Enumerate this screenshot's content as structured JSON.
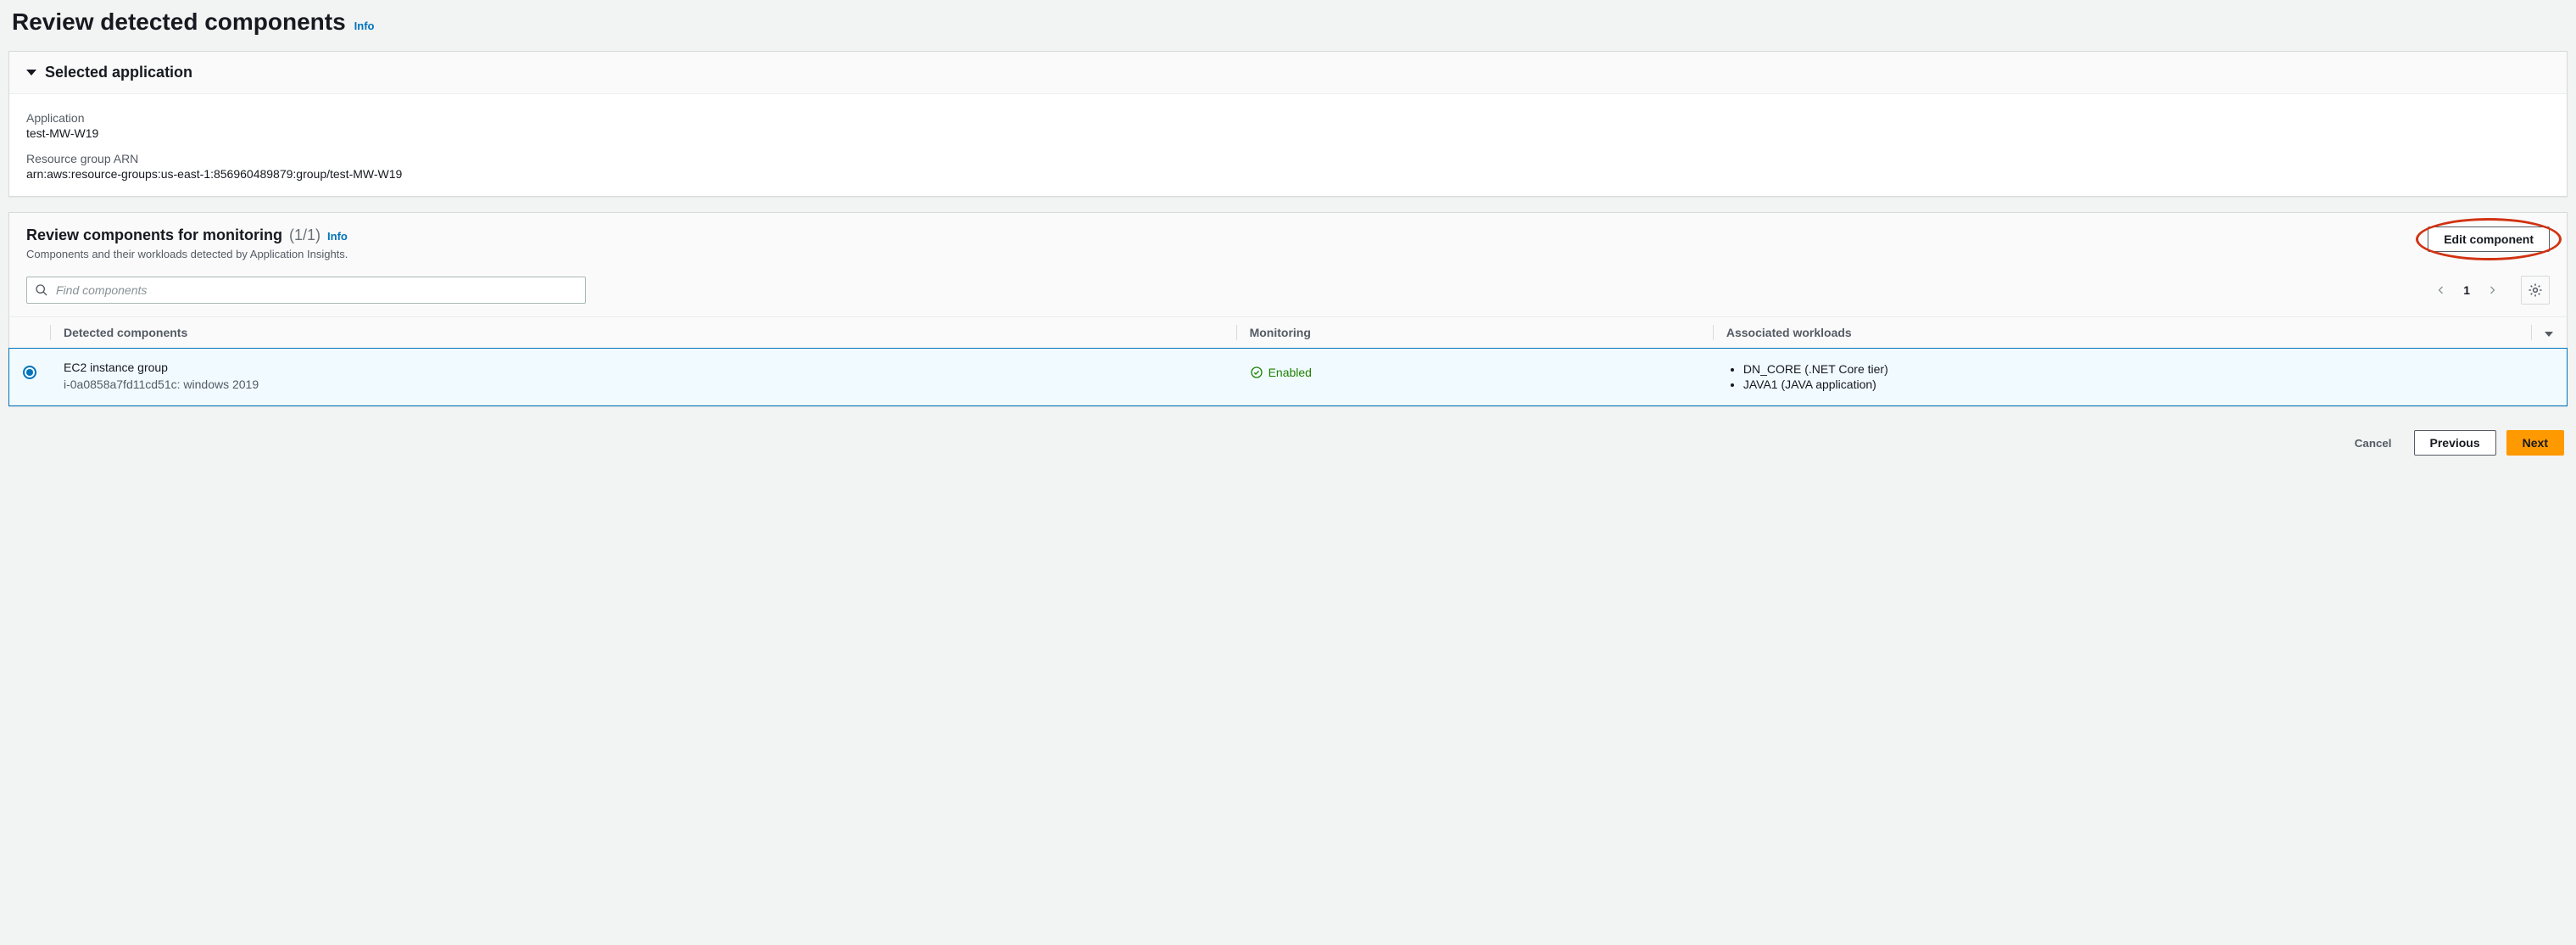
{
  "page": {
    "title": "Review detected components",
    "info": "Info"
  },
  "selected_app": {
    "heading": "Selected application",
    "application_label": "Application",
    "application_value": "test-MW-W19",
    "arn_label": "Resource group ARN",
    "arn_value": "arn:aws:resource-groups:us-east-1:856960489879:group/test-MW-W19"
  },
  "components_panel": {
    "title": "Review components for monitoring",
    "count": "(1/1)",
    "info": "Info",
    "subtitle": "Components and their workloads detected by Application Insights.",
    "edit_button": "Edit component",
    "search_placeholder": "Find components",
    "page_number": "1",
    "columns": {
      "detected": "Detected components",
      "monitoring": "Monitoring",
      "workloads": "Associated workloads"
    },
    "row": {
      "name": "EC2 instance group",
      "sub": "i-0a0858a7fd11cd51c: windows 2019",
      "status": "Enabled",
      "workload1": "DN_CORE (.NET Core tier)",
      "workload2": "JAVA1 (JAVA application)"
    }
  },
  "footer": {
    "cancel": "Cancel",
    "previous": "Previous",
    "next": "Next"
  }
}
